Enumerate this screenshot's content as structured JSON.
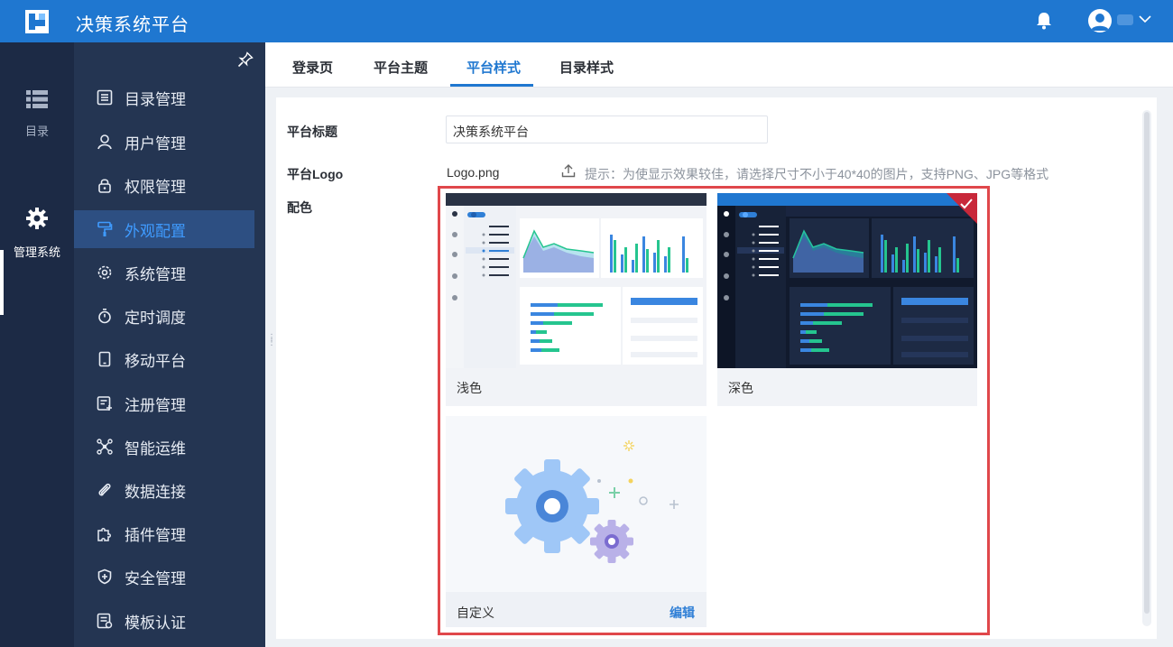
{
  "app": {
    "title": "决策系统平台"
  },
  "rail": {
    "items": [
      {
        "label": "目录",
        "icon": "list-icon"
      },
      {
        "label": "管理系统",
        "icon": "gear-icon",
        "active": true
      }
    ]
  },
  "menu": {
    "items": [
      {
        "label": "目录管理",
        "icon": "catalog-icon"
      },
      {
        "label": "用户管理",
        "icon": "user-icon"
      },
      {
        "label": "权限管理",
        "icon": "lock-icon"
      },
      {
        "label": "外观配置",
        "icon": "paint-roller-icon",
        "active": true
      },
      {
        "label": "系统管理",
        "icon": "settings-icon"
      },
      {
        "label": "定时调度",
        "icon": "stopwatch-icon"
      },
      {
        "label": "移动平台",
        "icon": "tablet-icon"
      },
      {
        "label": "注册管理",
        "icon": "register-icon"
      },
      {
        "label": "智能运维",
        "icon": "network-icon"
      },
      {
        "label": "数据连接",
        "icon": "paperclip-icon"
      },
      {
        "label": "插件管理",
        "icon": "puzzle-icon"
      },
      {
        "label": "安全管理",
        "icon": "shield-icon"
      },
      {
        "label": "模板认证",
        "icon": "template-cert-icon"
      }
    ]
  },
  "tabs": [
    {
      "label": "登录页"
    },
    {
      "label": "平台主题"
    },
    {
      "label": "平台样式",
      "active": true
    },
    {
      "label": "目录样式"
    }
  ],
  "form": {
    "title_label": "平台标题",
    "title_value": "决策系统平台",
    "logo_label": "平台Logo",
    "logo_file": "Logo.png",
    "logo_hint": "提示：为使显示效果较佳，请选择尺寸不小于40*40的图片，支持PNG、JPG等格式",
    "color_label": "配色"
  },
  "color_schemes": [
    {
      "label": "浅色",
      "selected": false
    },
    {
      "label": "深色",
      "selected": true
    },
    {
      "label": "自定义",
      "action": "编辑"
    }
  ],
  "colors": {
    "brand": "#1f77d0",
    "rail_bg": "#1c2a45",
    "menu_bg": "#243552",
    "menu_active_bg": "#2d4f82",
    "menu_active_text": "#3f9bff",
    "highlight_border": "#e0474b",
    "selected_corner": "#c8283a"
  }
}
